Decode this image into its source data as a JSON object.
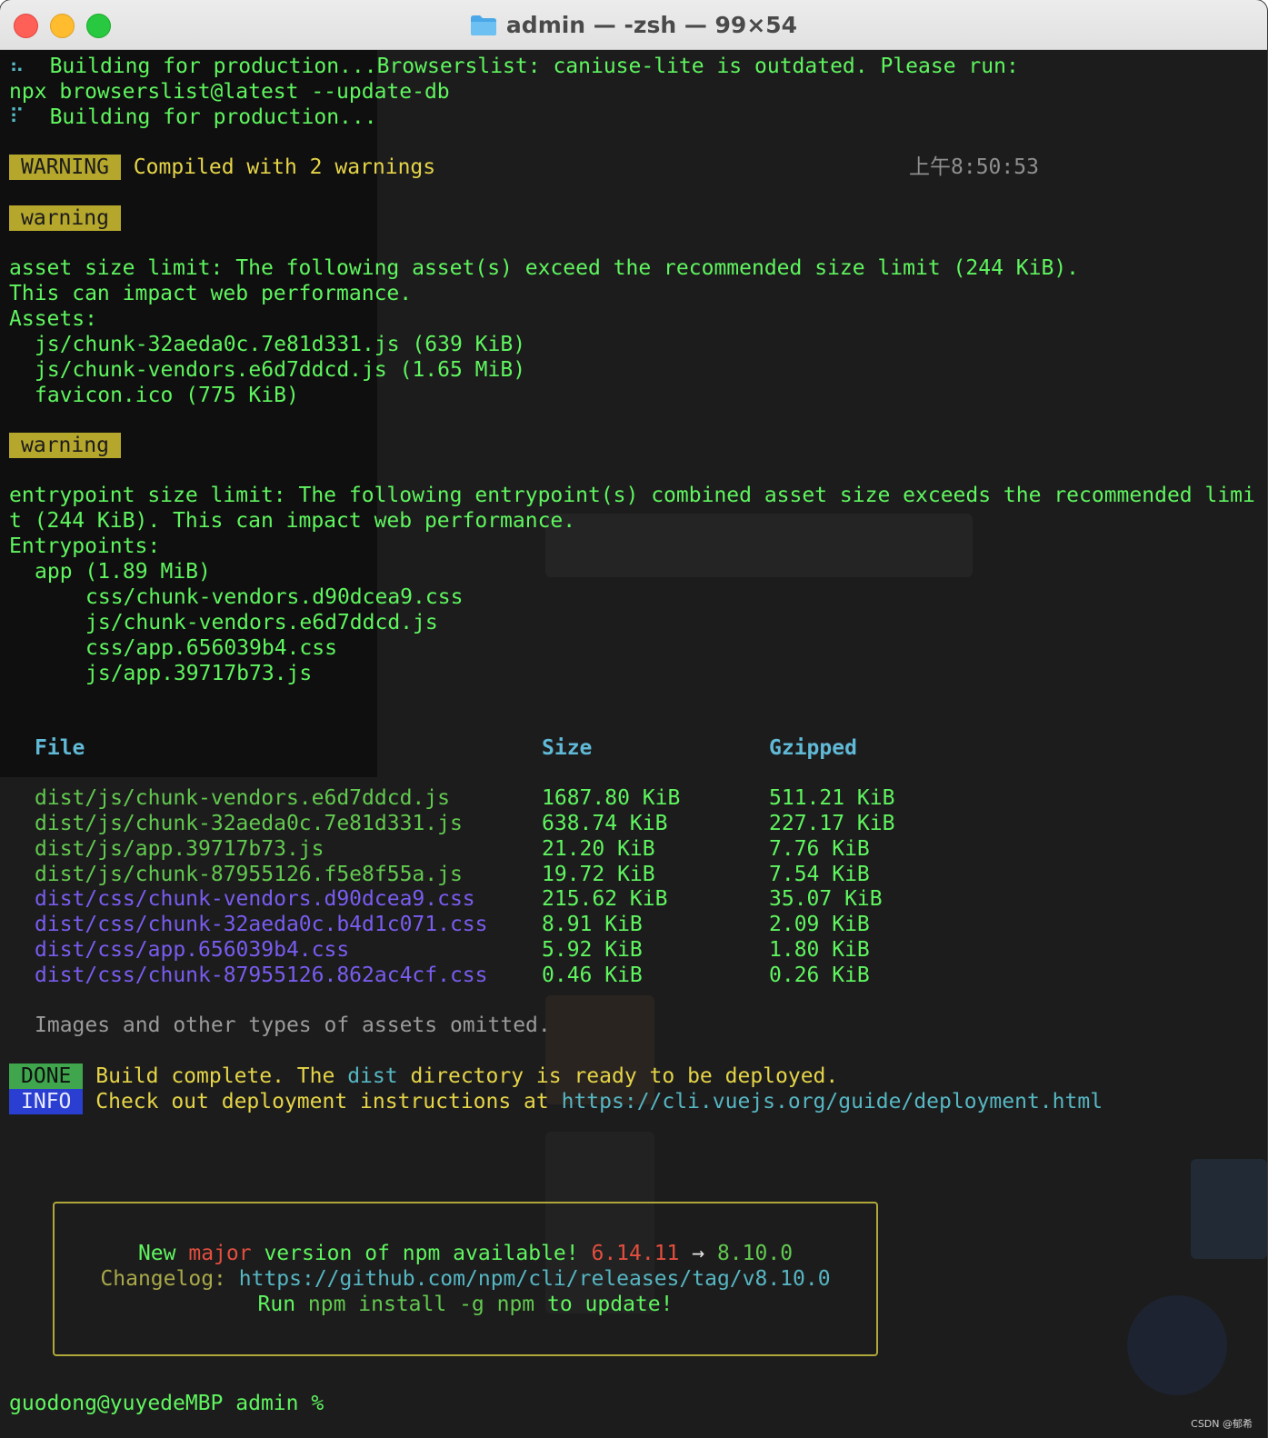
{
  "window": {
    "title": "admin — -zsh — 99×54",
    "icons": [
      "close-button",
      "minimize-button",
      "zoom-button",
      "folder-icon"
    ]
  },
  "terminal": {
    "spinner1": "⠦",
    "build1": "Building for production...Browserslist: caniuse-lite is outdated. Please run:",
    "update_cmd": "npx browserslist@latest --update-db",
    "spinner2": "⠏",
    "build2": "Building for production...",
    "warning_badge": "WARNING",
    "compiled": "Compiled with 2 warnings",
    "timestamp": "上午8:50:53",
    "warning1_badge": "warning",
    "asset_line1": "asset size limit: The following asset(s) exceed the recommended size limit (244 KiB).",
    "asset_line2": "This can impact web performance.",
    "assets_header": "Assets:",
    "assets": [
      "js/chunk-32aeda0c.7e81d331.js (639 KiB)",
      "js/chunk-vendors.e6d7ddcd.js (1.65 MiB)",
      "favicon.ico (775 KiB)"
    ],
    "warning2_badge": "warning",
    "entry_line1": "entrypoint size limit: The following entrypoint(s) combined asset size exceeds the recommended limi",
    "entry_line2": "t (244 KiB). This can impact web performance.",
    "entrypoints_header": "Entrypoints:",
    "entry_app": "app (1.89 MiB)",
    "entry_files": [
      "css/chunk-vendors.d90dcea9.css",
      "js/chunk-vendors.e6d7ddcd.js",
      "css/app.656039b4.css",
      "js/app.39717b73.js"
    ],
    "table": {
      "headers": {
        "file": "File",
        "size": "Size",
        "gzipped": "Gzipped"
      },
      "rows": [
        {
          "file": "dist/js/chunk-vendors.e6d7ddcd.js",
          "size": "1687.80 KiB",
          "gzipped": "511.21 KiB",
          "kind": "js"
        },
        {
          "file": "dist/js/chunk-32aeda0c.7e81d331.js",
          "size": "638.74 KiB",
          "gzipped": "227.17 KiB",
          "kind": "js"
        },
        {
          "file": "dist/js/app.39717b73.js",
          "size": "21.20 KiB",
          "gzipped": "7.76 KiB",
          "kind": "js"
        },
        {
          "file": "dist/js/chunk-87955126.f5e8f55a.js",
          "size": "19.72 KiB",
          "gzipped": "7.54 KiB",
          "kind": "js"
        },
        {
          "file": "dist/css/chunk-vendors.d90dcea9.css",
          "size": "215.62 KiB",
          "gzipped": "35.07 KiB",
          "kind": "css"
        },
        {
          "file": "dist/css/chunk-32aeda0c.b4d1c071.css",
          "size": "8.91 KiB",
          "gzipped": "2.09 KiB",
          "kind": "css"
        },
        {
          "file": "dist/css/app.656039b4.css",
          "size": "5.92 KiB",
          "gzipped": "1.80 KiB",
          "kind": "css"
        },
        {
          "file": "dist/css/chunk-87955126.862ac4cf.css",
          "size": "0.46 KiB",
          "gzipped": "0.26 KiB",
          "kind": "css"
        }
      ]
    },
    "omitted": "Images and other types of assets omitted.",
    "done_badge": "DONE",
    "done_pre": "Build complete. The ",
    "done_dist": "dist",
    "done_post": " directory is ready to be deployed.",
    "info_badge": "INFO",
    "info_pre": "Check out deployment instructions at ",
    "info_url": "https://cli.vuejs.org/guide/deployment.html",
    "npm": {
      "new": "New ",
      "major": "major",
      "version_text": " version of npm available! ",
      "old_version": "6.14.11",
      "arrow": " → ",
      "new_version": "8.10.0",
      "changelog_label": "Changelog: ",
      "changelog_url": "https://github.com/npm/cli/releases/tag/v8.10.0",
      "run": "Run ",
      "cmd": "npm install -g npm",
      "to_update": " to update!"
    },
    "prompt": "guodong@yuyedeMBP admin % "
  },
  "watermark": "CSDN @郁希",
  "colors": {
    "terminal_bg": "#1c1c1c",
    "green": "#5ff55f",
    "yellow_badge": "#b5a62c",
    "done_badge": "#3fa64e",
    "info_badge": "#2a3fd1",
    "css_purple": "#7a5cf0",
    "header_cyan": "#60b9d6"
  }
}
